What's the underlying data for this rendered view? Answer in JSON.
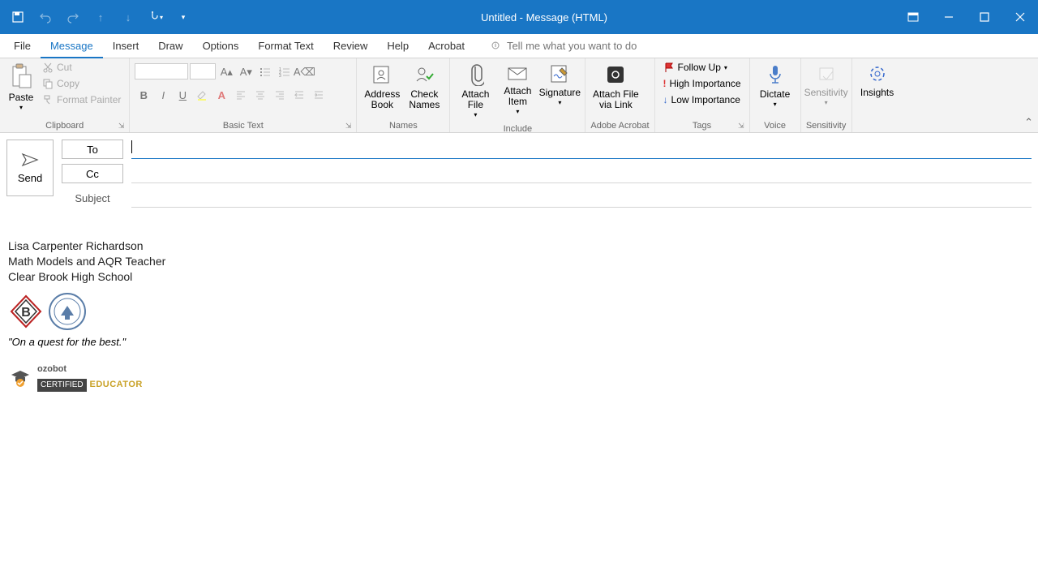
{
  "titlebar": {
    "title": "Untitled  -  Message (HTML)"
  },
  "tabs": {
    "file": "File",
    "message": "Message",
    "insert": "Insert",
    "draw": "Draw",
    "options": "Options",
    "format_text": "Format Text",
    "review": "Review",
    "help": "Help",
    "acrobat": "Acrobat"
  },
  "tellme": {
    "placeholder": "Tell me what you want to do"
  },
  "ribbon": {
    "clipboard": {
      "paste": "Paste",
      "cut": "Cut",
      "copy": "Copy",
      "format_painter": "Format Painter",
      "label": "Clipboard"
    },
    "basic_text": {
      "bold": "B",
      "italic": "I",
      "underline": "U",
      "label": "Basic Text"
    },
    "names": {
      "address_book": "Address Book",
      "check_names": "Check Names",
      "label": "Names"
    },
    "include": {
      "attach_file": "Attach File",
      "attach_item": "Attach Item",
      "signature": "Signature",
      "label": "Include"
    },
    "adobe": {
      "attach_link": "Attach File via Link",
      "label": "Adobe Acrobat"
    },
    "tags": {
      "follow_up": "Follow Up",
      "high": "High Importance",
      "low": "Low Importance",
      "label": "Tags"
    },
    "voice": {
      "dictate": "Dictate",
      "label": "Voice"
    },
    "sensitivity": {
      "sensitivity": "Sensitivity",
      "label": "Sensitivity"
    },
    "insights": {
      "insights": "Insights"
    }
  },
  "compose": {
    "send": "Send",
    "to": "To",
    "cc": "Cc",
    "subject": "Subject"
  },
  "signature": {
    "name": "Lisa Carpenter Richardson",
    "title": "Math Models and AQR Teacher",
    "school": "Clear Brook High School",
    "motto": "\"On a quest for the best.\"",
    "ozobot_brand": "ozobot",
    "ozobot_cert": "CERTIFIED",
    "ozobot_edu": "EDUCATOR"
  }
}
